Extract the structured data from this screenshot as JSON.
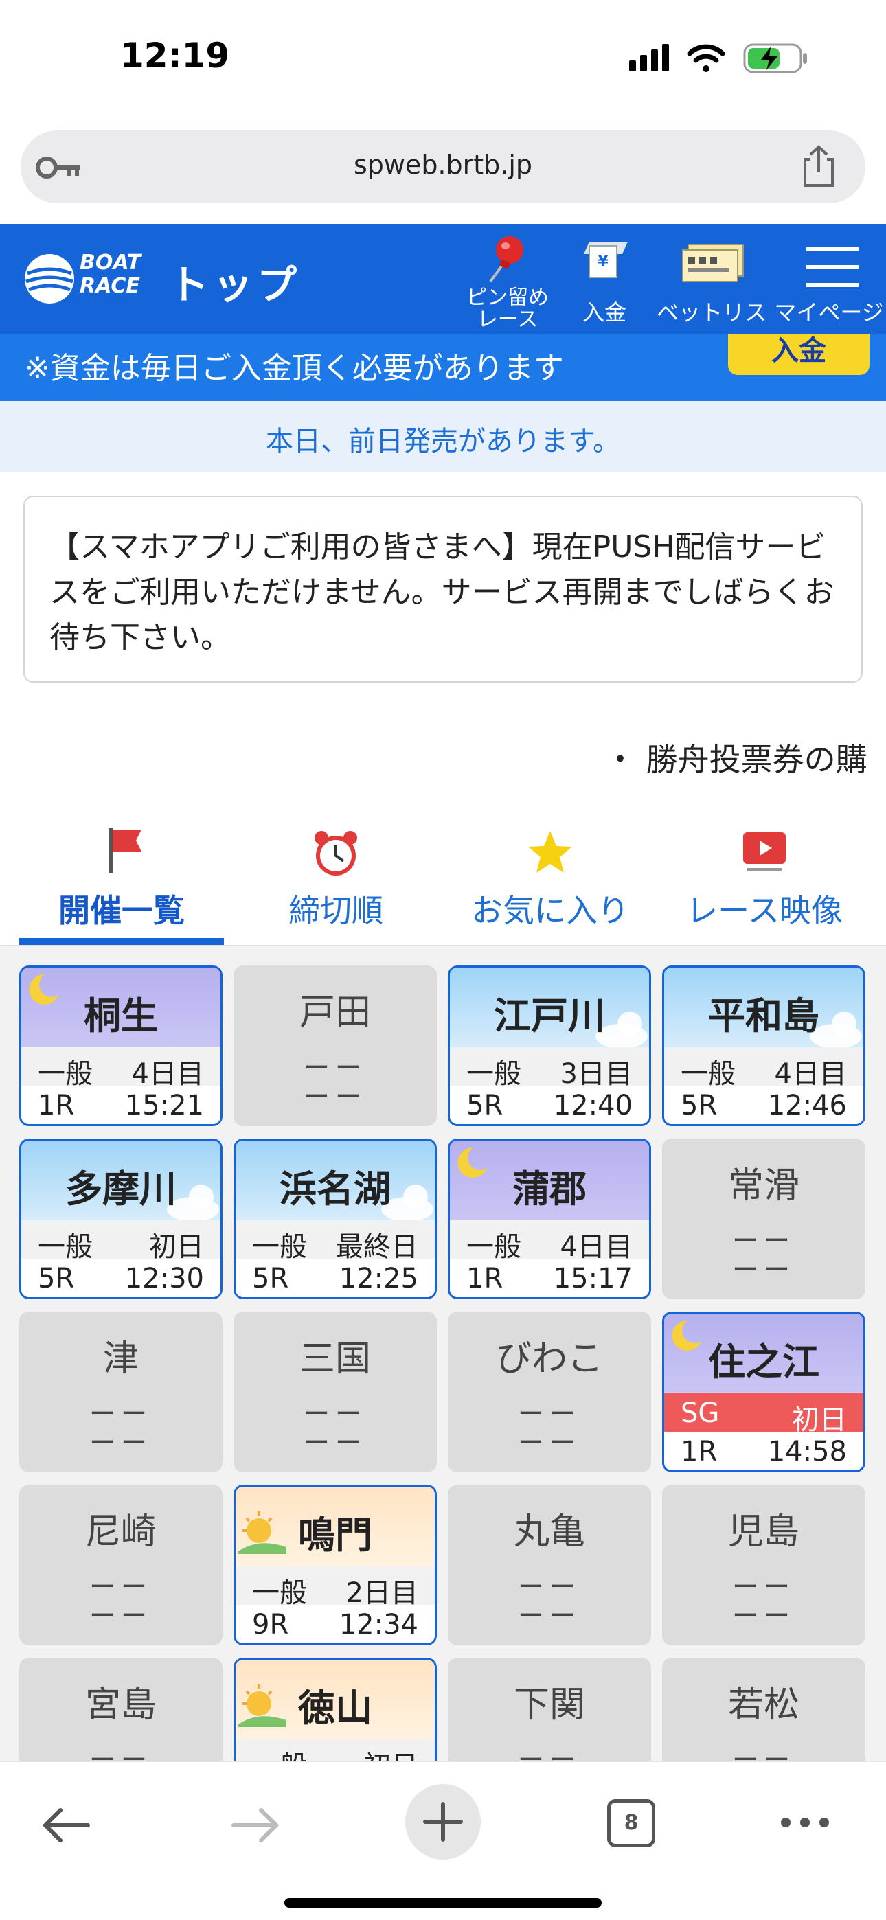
{
  "status": {
    "time": "12:19"
  },
  "browser": {
    "url": "spweb.brtb.jp",
    "tab_count": "8"
  },
  "header": {
    "logo_line1": "BOAT",
    "logo_line2": "RACE",
    "title": "トップ",
    "nav": [
      {
        "label": "ピン留め\nレース",
        "icon": "pin-icon"
      },
      {
        "label": "入金",
        "icon": "atm-icon"
      },
      {
        "label": "ベットリスト",
        "icon": "ticket-icon"
      },
      {
        "label": "マイページ",
        "icon": "menu-icon"
      }
    ]
  },
  "notice": {
    "text": "※資金は毎日ご入金頂く必要があります",
    "deposit_button": "入金"
  },
  "sales_banner": "本日、前日発売があります。",
  "info_box": "【スマホアプリご利用の皆さまへ】現在PUSH配信サービスをご利用いただけません。サービス再開までしばらくお待ち下さい。",
  "ticker": "・ 勝舟投票券の購",
  "tabs": [
    {
      "label": "開催一覧",
      "icon": "flag-icon",
      "active": true
    },
    {
      "label": "締切順",
      "icon": "alarm-clock-icon",
      "active": false
    },
    {
      "label": "お気に入り",
      "icon": "star-icon",
      "active": false
    },
    {
      "label": "レース映像",
      "icon": "video-icon",
      "active": false
    }
  ],
  "venues": [
    {
      "name": "桐生",
      "open": true,
      "theme": "night",
      "grade": "一般",
      "day": "4日目",
      "race": "1R",
      "time": "15:21"
    },
    {
      "name": "戸田",
      "open": false,
      "l1": "ーー",
      "l2": "ーー"
    },
    {
      "name": "江戸川",
      "open": true,
      "theme": "day",
      "grade": "一般",
      "day": "3日目",
      "race": "5R",
      "time": "12:40"
    },
    {
      "name": "平和島",
      "open": true,
      "theme": "day",
      "grade": "一般",
      "day": "4日目",
      "race": "5R",
      "time": "12:46"
    },
    {
      "name": "多摩川",
      "open": true,
      "theme": "day",
      "grade": "一般",
      "day": "初日",
      "race": "5R",
      "time": "12:30"
    },
    {
      "name": "浜名湖",
      "open": true,
      "theme": "day",
      "grade": "一般",
      "day": "最終日",
      "race": "5R",
      "time": "12:25"
    },
    {
      "name": "蒲郡",
      "open": true,
      "theme": "night",
      "grade": "一般",
      "day": "4日目",
      "race": "1R",
      "time": "15:17"
    },
    {
      "name": "常滑",
      "open": false,
      "l1": "ーー",
      "l2": "ーー"
    },
    {
      "name": "津",
      "open": false,
      "l1": "ーー",
      "l2": "ーー"
    },
    {
      "name": "三国",
      "open": false,
      "l1": "ーー",
      "l2": "ーー"
    },
    {
      "name": "びわこ",
      "open": false,
      "l1": "ーー",
      "l2": "ーー"
    },
    {
      "name": "住之江",
      "open": true,
      "theme": "night",
      "grade": "SG",
      "day": "初日",
      "race": "1R",
      "time": "14:58",
      "sg": true
    },
    {
      "name": "尼崎",
      "open": false,
      "l1": "ーー",
      "l2": "ーー"
    },
    {
      "name": "鳴門",
      "open": true,
      "theme": "morning",
      "grade": "一般",
      "day": "2日目",
      "race": "9R",
      "time": "12:34"
    },
    {
      "name": "丸亀",
      "open": false,
      "l1": "ーー",
      "l2": "ーー"
    },
    {
      "name": "児島",
      "open": false,
      "l1": "ーー",
      "l2": "ーー"
    },
    {
      "name": "宮島",
      "open": false,
      "l1": "ーー",
      "l2": "ーー"
    },
    {
      "name": "徳山",
      "open": true,
      "theme": "morning",
      "grade": "一般",
      "day": "初日",
      "race": "",
      "time": ""
    },
    {
      "name": "下関",
      "open": false,
      "l1": "ーー",
      "l2": "ーー"
    },
    {
      "name": "若松",
      "open": false,
      "l1": "ーー",
      "l2": "ーー"
    }
  ],
  "colors": {
    "brand_blue": "#1565d8",
    "notice_blue": "#1e79e8",
    "deposit_yellow": "#f7d628",
    "sg_red": "#ee5a5a"
  }
}
